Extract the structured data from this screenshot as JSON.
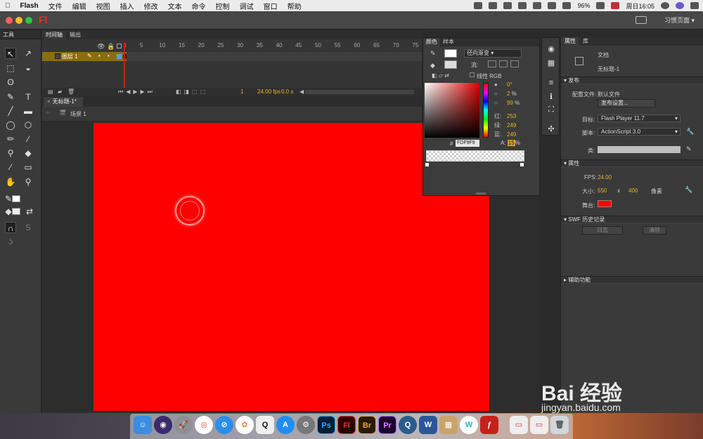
{
  "menubar": {
    "app": "Flash",
    "items": [
      "文件",
      "编辑",
      "视图",
      "插入",
      "修改",
      "文本",
      "命令",
      "控制",
      "调试",
      "窗口",
      "帮助"
    ],
    "battery": "96%",
    "clock": "周日16:05"
  },
  "titlebar": {
    "app_mark": "Fl",
    "workspace": "习惯页面"
  },
  "tools": {
    "title": "工具"
  },
  "timeline": {
    "tab_timeline": "时间轴",
    "tab_output": "输出",
    "layer": "图层 1",
    "frames": [
      "1",
      "5",
      "10",
      "15",
      "20",
      "25",
      "30",
      "35",
      "40",
      "45",
      "50",
      "55",
      "60",
      "65",
      "70",
      "75"
    ],
    "current_frame": "1",
    "fps": "24.00 fps",
    "time": "0.0 s"
  },
  "document": {
    "tab": "无标题-1*",
    "scene": "场景 1"
  },
  "color_panel": {
    "tab_color": "颜色",
    "tab_swatch": "样本",
    "type": "径向渐变",
    "flow_label": "流:",
    "linear_rgb": "线性 RGB",
    "h_val": "0°",
    "s_val": "2",
    "b_val": "99",
    "pct": "%",
    "r_label": "红:",
    "r_val": "253",
    "g_label": "绿:",
    "g_val": "249",
    "b_label": "蓝:",
    "blue_val": "249",
    "hex_hash": "#",
    "hex": "FDF9F9",
    "alpha_label": "A:",
    "alpha_val": "15",
    "accent": "#e8b420"
  },
  "properties": {
    "tab_props": "属性",
    "tab_library": "库",
    "doc_label": "文档",
    "doc_name": "无标题-1",
    "publish_section": "发布",
    "profile_label": "配置文件:",
    "profile_val": "默认文件",
    "publish_settings": "发布设置...",
    "target_label": "目标:",
    "target_val": "Flash Player 11.7",
    "script_label": "脚本:",
    "script_val": "ActionScript 3.0",
    "class_label": "类:",
    "props_section": "属性",
    "fps_label": "FPS:",
    "fps_val": "24.00",
    "size_label": "大小:",
    "width": "550",
    "x": "x",
    "height": "400",
    "unit": "像素",
    "stage_label": "舞台:",
    "stage_color": "#ff0000",
    "swf_section": "SWF 历史记录",
    "log_btn": "日志",
    "clear_btn": "清除",
    "access_section": "辅助功能"
  },
  "watermark": {
    "logo": "Bai 经验",
    "url": "jingyan.baidu.com"
  }
}
